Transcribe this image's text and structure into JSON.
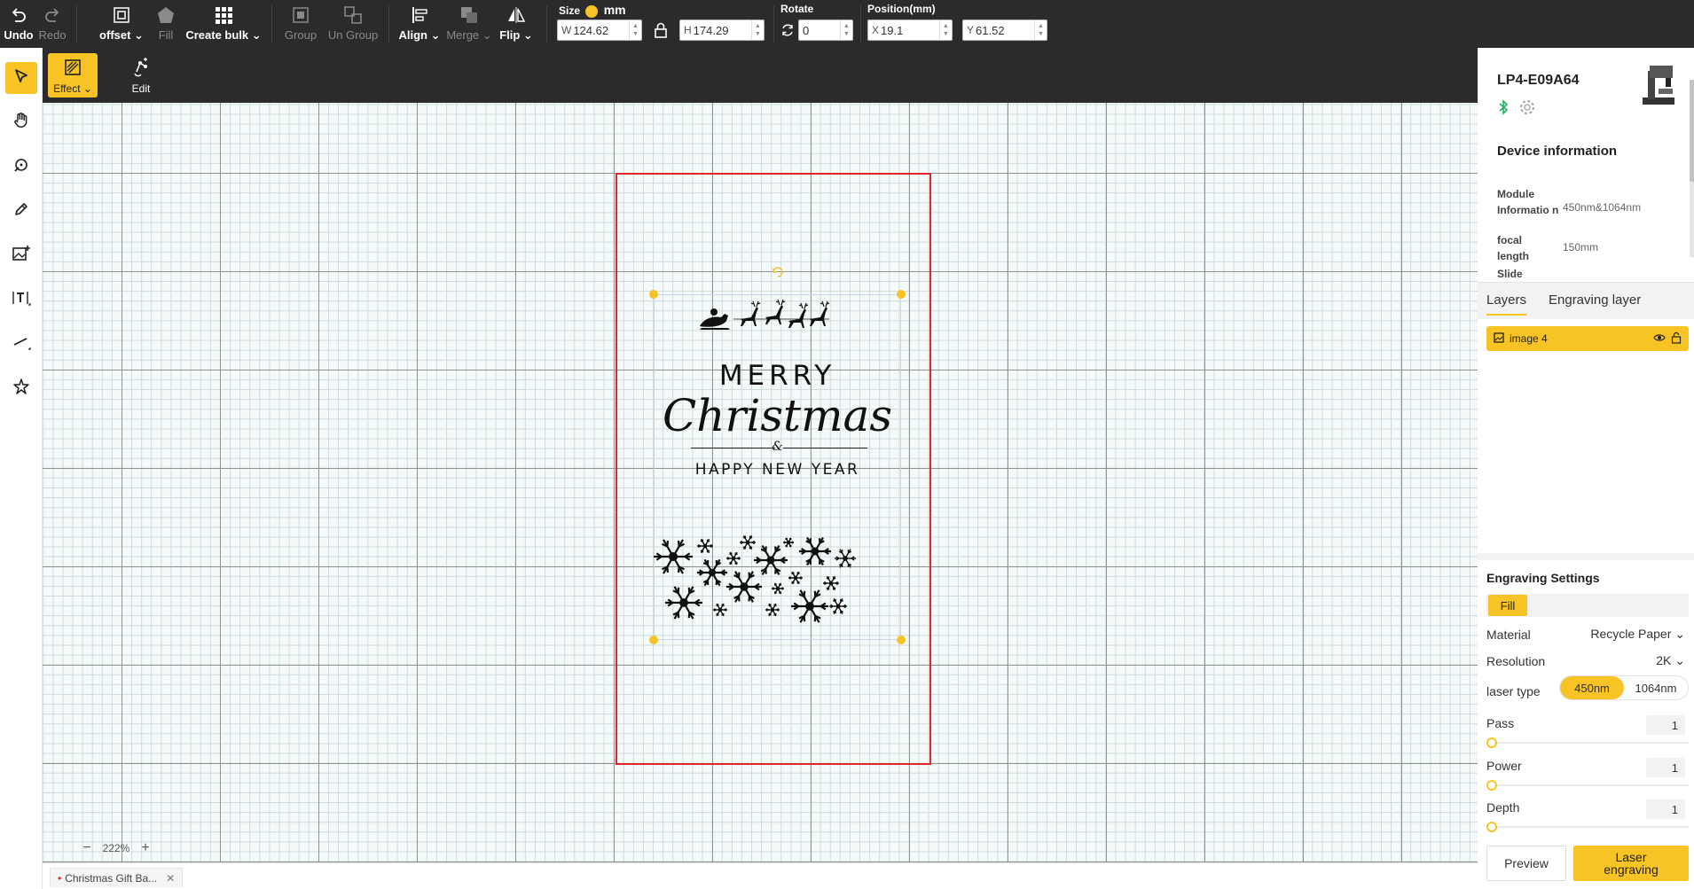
{
  "toolbar": {
    "undo": "Undo",
    "redo": "Redo",
    "offset": "offset",
    "fill": "Fill",
    "create_bulk": "Create bulk",
    "group": "Group",
    "ungroup": "Un Group",
    "align": "Align",
    "merge": "Merge",
    "flip": "Flip",
    "size_label": "Size",
    "unit": "mm",
    "width_prefix": "W",
    "width": "124.62",
    "height_prefix": "H",
    "height": "174.29",
    "rotate_label": "Rotate",
    "rotate": "0",
    "position_label": "Position(mm)",
    "x_prefix": "X",
    "x": "19.1",
    "y_prefix": "Y",
    "y": "61.52"
  },
  "subbar": {
    "effect": "Effect",
    "edit": "Edit"
  },
  "artwork": {
    "line1": "MERRY",
    "line2": "Christmas",
    "line3": "&",
    "line4": "HAPPY NEW YEAR"
  },
  "canvas": {
    "zoom": "222%"
  },
  "tabs": {
    "file": "Christmas Gift Ba..."
  },
  "device": {
    "name": "LP4-E09A64",
    "info_title": "Device information",
    "module_key": "Module Informatio n",
    "module_val": "450nm&1064nm",
    "focal_key": "focal length",
    "focal_val": "150mm",
    "slide_key": "Slide"
  },
  "layers": {
    "tab_layers": "Layers",
    "tab_engraving": "Engraving layer",
    "items": [
      {
        "name": "image 4"
      }
    ]
  },
  "settings": {
    "title": "Engraving Settings",
    "mode": "Fill",
    "material_label": "Material",
    "material": "Recycle Paper",
    "resolution_label": "Resolution",
    "resolution": "2K",
    "laser_label": "laser type",
    "laser_opt1": "450nm",
    "laser_opt2": "1064nm",
    "pass_label": "Pass",
    "pass": "1",
    "power_label": "Power",
    "power": "1",
    "depth_label": "Depth",
    "depth": "1",
    "preview": "Preview",
    "engrave": "Laser engraving"
  },
  "colors": {
    "accent": "#f7c325",
    "artboard": "#e0262b",
    "toolbar": "#2b2b2b"
  }
}
